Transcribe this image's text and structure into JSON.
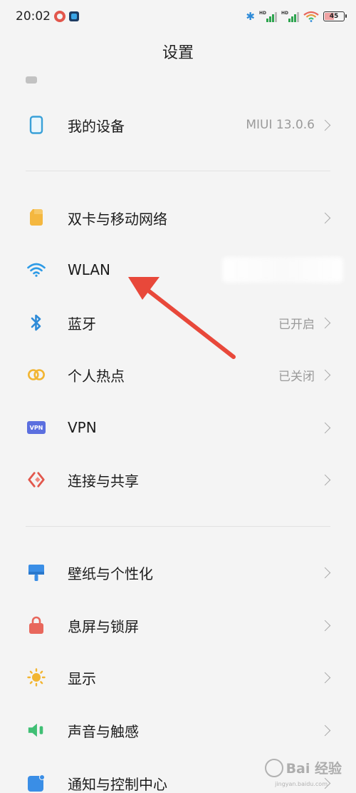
{
  "status_bar": {
    "time": "20:02",
    "signal1_label": "HD",
    "signal2_label": "HD",
    "battery": "45",
    "battery_level": 0.45
  },
  "title": "设置",
  "sections": {
    "device": {
      "label": "我的设备",
      "value": "MIUI 13.0.6",
      "icon": "phone-icon"
    },
    "network": [
      {
        "label": "双卡与移动网络",
        "value": "",
        "icon": "sim-card-icon"
      },
      {
        "label": "WLAN",
        "value": "",
        "icon": "wifi-icon"
      },
      {
        "label": "蓝牙",
        "value": "已开启",
        "icon": "bluetooth-icon"
      },
      {
        "label": "个人热点",
        "value": "已关闭",
        "icon": "hotspot-icon"
      },
      {
        "label": "VPN",
        "value": "",
        "icon": "vpn-icon"
      },
      {
        "label": "连接与共享",
        "value": "",
        "icon": "connection-sharing-icon"
      }
    ],
    "personal": [
      {
        "label": "壁纸与个性化",
        "value": "",
        "icon": "wallpaper-icon"
      },
      {
        "label": "息屏与锁屏",
        "value": "",
        "icon": "lock-icon"
      },
      {
        "label": "显示",
        "value": "",
        "icon": "brightness-icon"
      },
      {
        "label": "声音与触感",
        "value": "",
        "icon": "speaker-icon"
      },
      {
        "label": "通知与控制中心",
        "value": "",
        "icon": "notification-icon"
      }
    ]
  },
  "icons": {
    "vpn_badge": "VPN"
  },
  "colors": {
    "device": "#39a0d8",
    "sim": "#f4b73f",
    "wifi": "#2e9be6",
    "bluetooth": "#2e8bd8",
    "hotspot": "#f2b532",
    "vpn": "#5b6fdf",
    "connection": "#e2574c",
    "wallpaper": "#3a8ee6",
    "lock": "#e8675c",
    "display": "#f2b532",
    "sound": "#3fbf74",
    "notification": "#3a8ee6",
    "arrow": "#e8483a"
  },
  "watermark": {
    "text": "Bai 经验",
    "sub": "jingyan.baidu.com"
  }
}
